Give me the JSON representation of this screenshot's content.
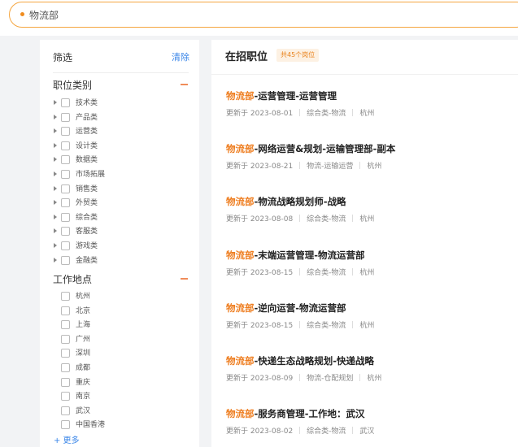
{
  "search": {
    "value": "物流部"
  },
  "filter": {
    "title": "筛选",
    "clear_label": "清除",
    "categories_title": "职位类别",
    "categories": [
      "技术类",
      "产品类",
      "运营类",
      "设计类",
      "数据类",
      "市场拓展",
      "销售类",
      "外贸类",
      "综合类",
      "客服类",
      "游戏类",
      "金融类"
    ],
    "locations_title": "工作地点",
    "locations": [
      "杭州",
      "北京",
      "上海",
      "广州",
      "深圳",
      "成都",
      "重庆",
      "南京",
      "武汉",
      "中国香港"
    ],
    "more_label": "+ 更多"
  },
  "main": {
    "title": "在招职位",
    "count_label": "共45个岗位",
    "jobs": [
      {
        "dept": "物流部",
        "rest": "-运营管理-运营管理",
        "updated": "更新于 2023-08-01",
        "category": "综合类-物流",
        "city": "杭州"
      },
      {
        "dept": "物流部",
        "rest": "-网络运营&规划-运输管理部-副本",
        "updated": "更新于 2023-08-21",
        "category": "物流-运输运营",
        "city": "杭州"
      },
      {
        "dept": "物流部",
        "rest": "-物流战略规划师-战略",
        "updated": "更新于 2023-08-08",
        "category": "综合类-物流",
        "city": "杭州"
      },
      {
        "dept": "物流部",
        "rest": "-末端运营管理-物流运营部",
        "updated": "更新于 2023-08-15",
        "category": "综合类-物流",
        "city": "杭州"
      },
      {
        "dept": "物流部",
        "rest": "-逆向运营-物流运营部",
        "updated": "更新于 2023-08-15",
        "category": "综合类-物流",
        "city": "杭州"
      },
      {
        "dept": "物流部",
        "rest": "-快递生态战略规划-快递战略",
        "updated": "更新于 2023-08-09",
        "category": "物流-仓配规划",
        "city": "杭州"
      },
      {
        "dept": "物流部",
        "rest": "-服务商管理-工作地：武汉",
        "updated": "更新于 2023-08-02",
        "category": "综合类-物流",
        "city": "武汉"
      }
    ]
  }
}
